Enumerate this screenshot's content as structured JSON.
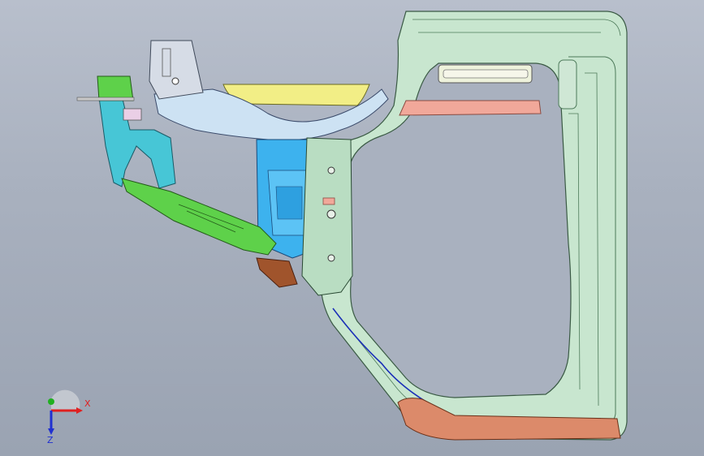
{
  "viewport": {
    "background_top": "#b8bfcc",
    "background_bottom": "#9aa3b2"
  },
  "model": {
    "parts": [
      {
        "name": "outer-door-frame",
        "color": "#c8e6cf"
      },
      {
        "name": "yellow-roof-rail",
        "color": "#f2ee86"
      },
      {
        "name": "salmon-rail",
        "color": "#f1a89a"
      },
      {
        "name": "light-blue-upper-member",
        "color": "#cde2f3"
      },
      {
        "name": "blue-hinge-pillar",
        "color": "#3db2ee"
      },
      {
        "name": "cyan-bracket",
        "color": "#47c6d6"
      },
      {
        "name": "green-lower-member",
        "color": "#5ed14a"
      },
      {
        "name": "orange-sill-panel",
        "color": "#dc8a6a"
      },
      {
        "name": "brown-bracket",
        "color": "#a0542c"
      },
      {
        "name": "navy-seal-line",
        "color": "#1b2fb8"
      }
    ]
  },
  "triad": {
    "x_label": "X",
    "z_label": "Z",
    "x_color": "#e02020",
    "y_color": "#20b020",
    "z_color": "#2030d0"
  }
}
